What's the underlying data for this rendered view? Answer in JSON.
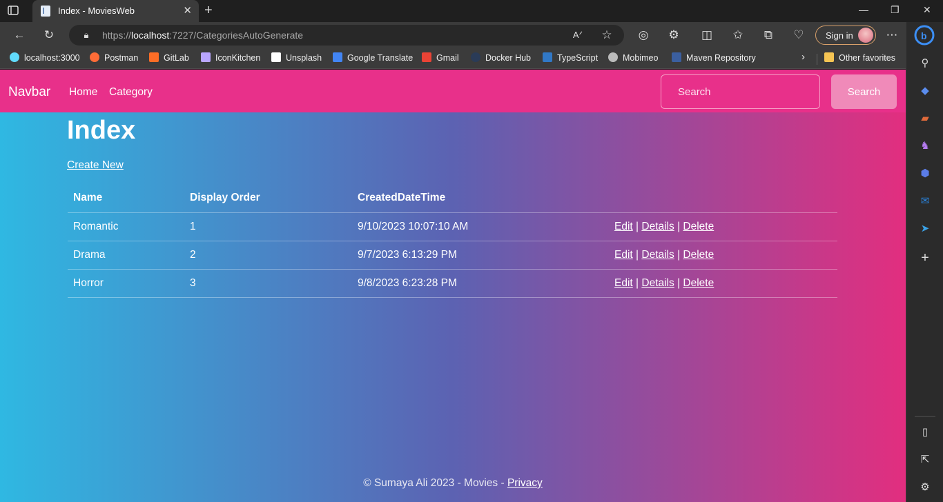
{
  "browser": {
    "tab_title": "Index - MoviesWeb",
    "url_prefix": "https://",
    "url_host": "localhost",
    "url_rest": ":7227/CategoriesAutoGenerate",
    "sign_in": "Sign in",
    "favorites": [
      {
        "label": "localhost:3000",
        "icon": "react-icon",
        "color": "#61dafb"
      },
      {
        "label": "Postman",
        "icon": "postman-icon",
        "color": "#ff6c37"
      },
      {
        "label": "GitLab",
        "icon": "gitlab-icon",
        "color": "#fc6d26"
      },
      {
        "label": "IconKitchen",
        "icon": "iconkitchen-icon",
        "color": "#b9a6ff"
      },
      {
        "label": "Unsplash",
        "icon": "unsplash-icon",
        "color": "#ffffff"
      },
      {
        "label": "Google Translate",
        "icon": "translate-icon",
        "color": "#4285f4"
      },
      {
        "label": "Gmail",
        "icon": "gmail-icon",
        "color": "#ea4335"
      },
      {
        "label": "Docker Hub",
        "icon": "docker-icon",
        "color": "#2a3b57"
      },
      {
        "label": "TypeScript",
        "icon": "typescript-icon",
        "color": "#3178c6"
      },
      {
        "label": "Mobimeo",
        "icon": "mobimeo-icon",
        "color": "#bbbbbb"
      },
      {
        "label": "Maven Repository",
        "icon": "maven-icon",
        "color": "#3b5fa0"
      }
    ],
    "other_favorites": "Other favorites"
  },
  "site": {
    "brand": "Navbar",
    "nav": [
      "Home",
      "Category"
    ],
    "search_placeholder": "Search",
    "search_button": "Search",
    "accent": "#e8308a"
  },
  "main": {
    "heading": "Index",
    "create_link": "Create New",
    "columns": [
      "Name",
      "Display Order",
      "CreatedDateTime"
    ],
    "rows": [
      {
        "name": "Romantic",
        "order": "1",
        "created": "9/10/2023 10:07:10 AM"
      },
      {
        "name": "Drama",
        "order": "2",
        "created": "9/7/2023 6:13:29 PM"
      },
      {
        "name": "Horror",
        "order": "3",
        "created": "9/8/2023 6:23:28 PM"
      }
    ],
    "actions": {
      "edit": "Edit",
      "details": "Details",
      "delete": "Delete",
      "sep": "|"
    }
  },
  "footer": {
    "text": "© Sumaya Ali 2023 - Movies - ",
    "privacy": "Privacy"
  }
}
